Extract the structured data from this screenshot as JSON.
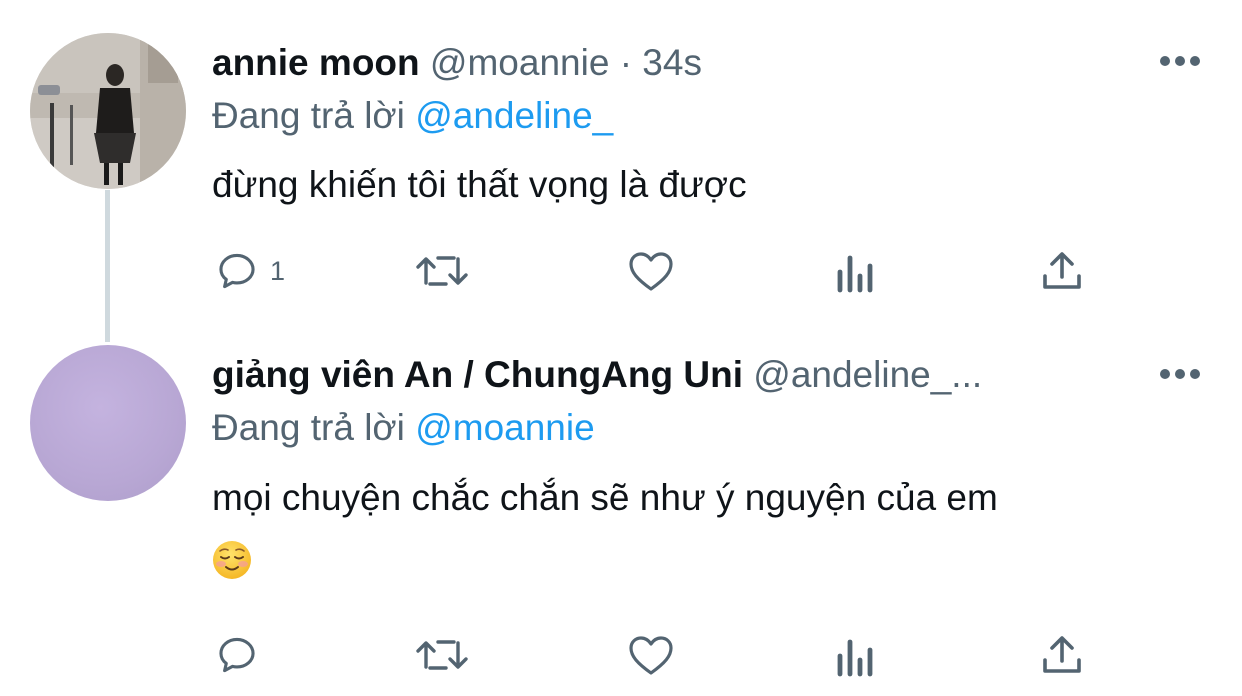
{
  "tweets": [
    {
      "display_name": "annie moon",
      "handle": "@moannie",
      "time": "· 34s",
      "replying_label": "Đang trả lời",
      "replying_to": "@andeline_",
      "text": "đừng khiến tôi thất vọng là được",
      "emoji": "",
      "reply_count": "1"
    },
    {
      "display_name": "giảng viên An / ChungAng Uni",
      "handle": "@andeline_...",
      "time": "",
      "replying_label": "Đang trả lời",
      "replying_to": "@moannie",
      "text": "mọi chuyện chắc chắn sẽ như ý nguyện của em",
      "emoji": "relieved-smiling-face",
      "reply_count": ""
    }
  ],
  "icons": [
    "reply-icon",
    "retweet-icon",
    "like-icon",
    "analytics-icon",
    "share-icon",
    "more-icon"
  ],
  "colors": {
    "mention": "#1d9bf0",
    "secondary_text": "#536471",
    "thread_line": "#cfd9de"
  }
}
